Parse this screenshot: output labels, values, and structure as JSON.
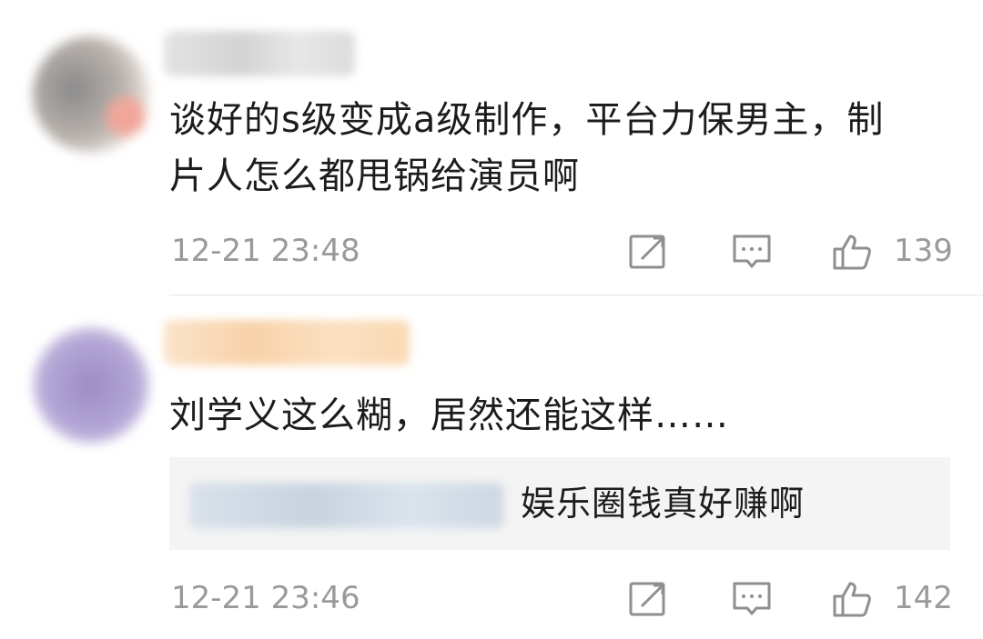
{
  "comments": [
    {
      "text_line1": "谈好的s级变成a级制作，平台力保男主，制",
      "text_line2": "片人怎么都甩锅给演员啊",
      "time": "12-21 23:48",
      "likes": "139",
      "avatar_icon": "avatar-icon",
      "actions": [
        "share-icon",
        "comment-icon",
        "like-icon"
      ]
    },
    {
      "text_line1": "刘学义这么糊，居然还能这样……",
      "reply_text": "娱乐圈钱真好赚啊",
      "time": "12-21 23:46",
      "likes": "142",
      "avatar_icon": "avatar-icon",
      "actions": [
        "share-icon",
        "comment-icon",
        "like-icon"
      ]
    }
  ],
  "colors": {
    "text": "#1c1c1c",
    "meta": "#9a9a9a",
    "reply_bg": "#f4f4f4",
    "divider": "#e6e6e6"
  }
}
